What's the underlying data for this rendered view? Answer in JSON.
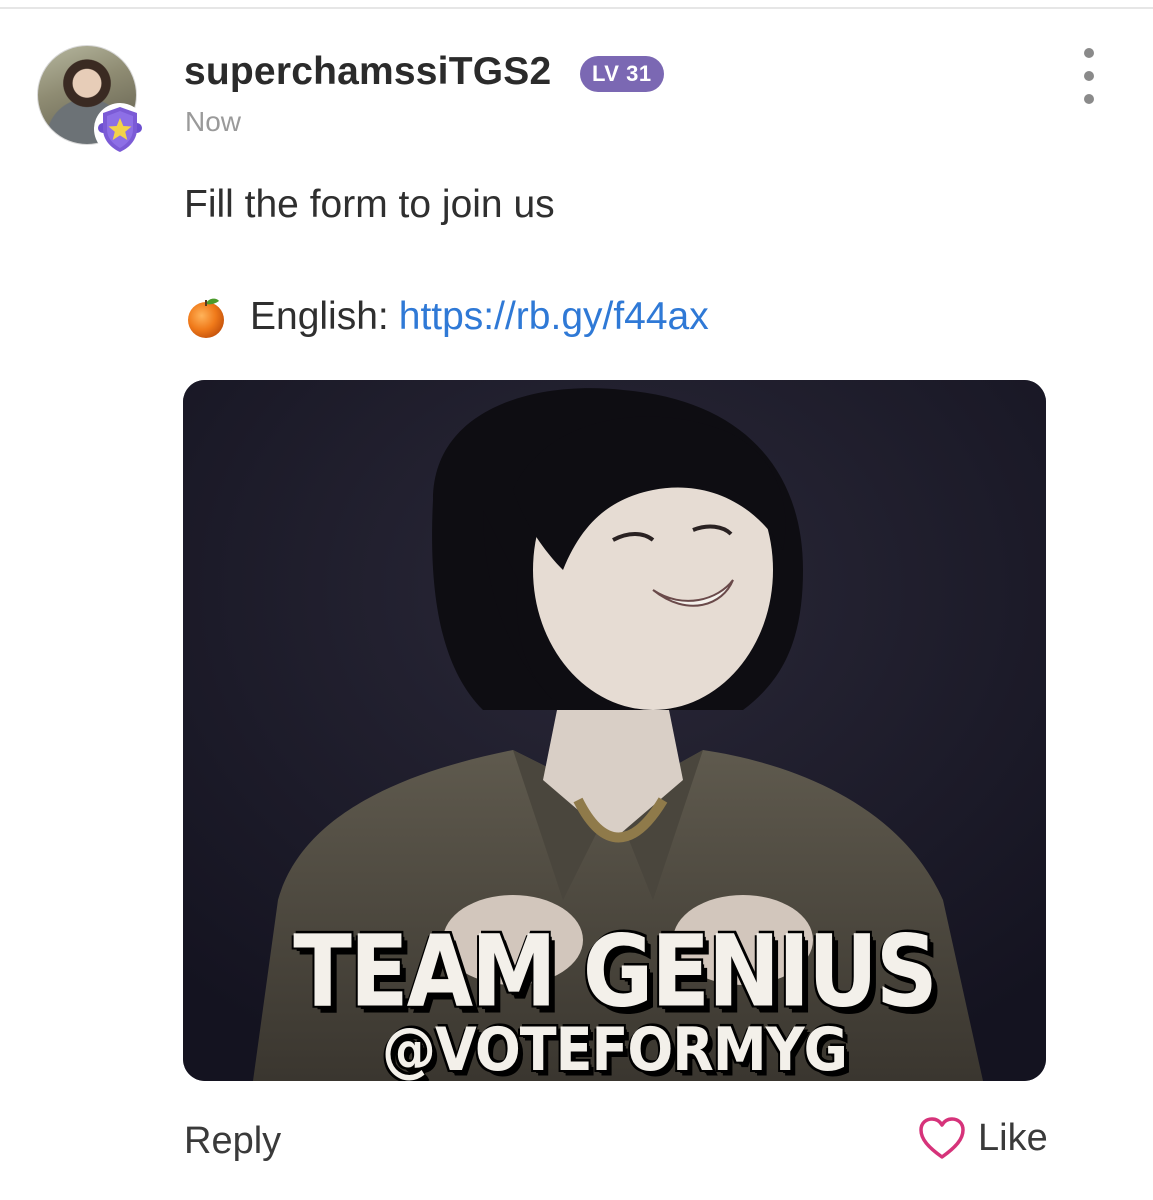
{
  "post": {
    "author": {
      "username": "superchamssiTGS2",
      "level": "LV 31",
      "timestamp": "Now",
      "avatar_icon": "user-avatar",
      "badge_icon": "shield-star-badge-icon",
      "badge_color": "#7b5bd6"
    },
    "content": {
      "line1": "Fill the form to join us",
      "line2_label": "English:",
      "line2_link": "https://rb.gy/f44ax",
      "line2_icon": "orange-emoji-icon"
    },
    "image": {
      "overlay_title": "TEAM GENIUS",
      "overlay_handle": "@VOTEFORMYG"
    },
    "actions": {
      "reply_label": "Reply",
      "like_label": "Like",
      "like_icon": "heart-outline-icon",
      "like_color": "#d6337a",
      "more_icon": "kebab-menu-icon"
    },
    "colors": {
      "link": "#2f79d6",
      "level_badge": "#7b68b3"
    }
  }
}
